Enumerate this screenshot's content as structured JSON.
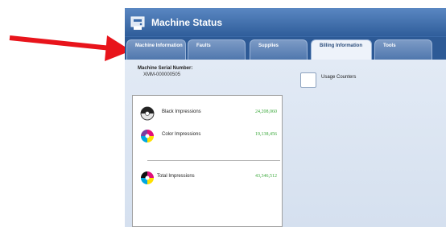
{
  "window": {
    "title": "Machine Status",
    "icon": "machine-status-icon"
  },
  "tabs": [
    {
      "label": "Machine Information",
      "active": false
    },
    {
      "label": "Faults",
      "active": false
    },
    {
      "label": "Supplies",
      "active": false
    },
    {
      "label": "Billing Information",
      "active": true
    },
    {
      "label": "Tools",
      "active": false
    }
  ],
  "billing": {
    "serial_label": "Machine Serial Number:",
    "serial_value": "XMM-000000505",
    "usage_counters_label": "Usage Counters",
    "counters": [
      {
        "label": "Black Impressions",
        "value": "24,208,060",
        "icon": "black-toner-icon"
      },
      {
        "label": "Color Impressions",
        "value": "19,138,456",
        "icon": "color-toner-icon"
      },
      {
        "label": "Total Impressions",
        "value": "43,346,512",
        "icon": "total-toner-icon"
      }
    ]
  },
  "annotation": {
    "arrow_color": "#e8141b"
  }
}
